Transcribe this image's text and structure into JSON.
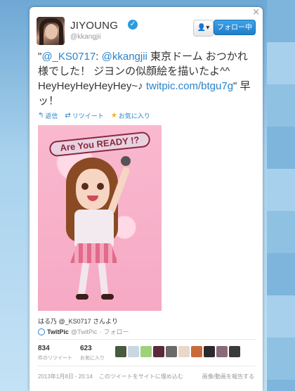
{
  "page_bg": "#9cc8e6",
  "accent": "#2a83c9",
  "close_label": "×",
  "user": {
    "name": "JIYOUNG",
    "handle": "@kkangjii",
    "verified_glyph": "✓"
  },
  "buttons": {
    "user_menu": "👤▾",
    "follow": "フォロー中"
  },
  "tweet": {
    "quote_open": "\"",
    "mention1": "@_KS0717",
    "colon1": ": ",
    "mention2": "@kkangjii",
    "text1": " 東京ドーム おつかれ様でした！ ジヨンの似顔絵を描いたよ^^ HeyHeyHeyHeyHey~♪ ",
    "link": "twitpic.com/btgu7g",
    "text2": "\" 早ッ！"
  },
  "actions": [
    {
      "icon": "reply-icon",
      "glyph": "↰",
      "label": "返信"
    },
    {
      "icon": "retweet-icon",
      "glyph": "⇄",
      "label": "リツイート"
    },
    {
      "icon": "star-icon",
      "glyph": "★",
      "label": "お気に入り"
    }
  ],
  "photo": {
    "banner_text": "Are You READY !?"
  },
  "credit": "はる乃 @_KS0717 さんより",
  "source": {
    "name": "TwitPic",
    "handle": "@TwitPic",
    "sep": "·",
    "follow": "フォロー"
  },
  "stats": [
    {
      "num": "834",
      "label": "件のリツイート"
    },
    {
      "num": "623",
      "label": "お気に入り"
    }
  ],
  "favoriters_colors": [
    "#4a5a3c",
    "#c9d6e3",
    "#9fd07a",
    "#5a2a3a",
    "#6a6a6a",
    "#e8d8c8",
    "#c86a3a",
    "#2a2a2a",
    "#8a6a7a",
    "#3a3a3a"
  ],
  "footer": {
    "timestamp": "2013年1月8日 - 20:14",
    "embed": "このツイートをサイトに埋め込む",
    "report": "画像/動画を報告する"
  }
}
